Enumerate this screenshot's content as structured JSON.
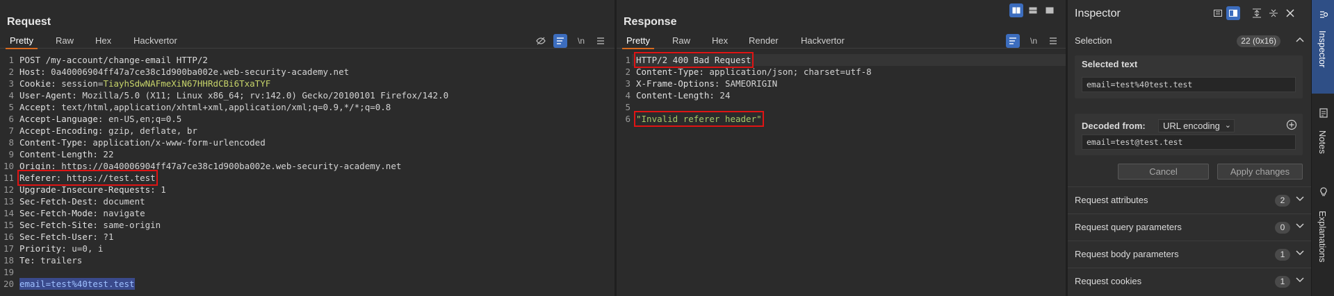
{
  "request": {
    "title": "Request",
    "tabs": [
      "Pretty",
      "Raw",
      "Hex",
      "Hackvertor"
    ],
    "lines": [
      {
        "n": "1",
        "text": "POST /my-account/change-email HTTP/2"
      },
      {
        "n": "2",
        "key": "Host",
        "value": "0a40006904ff47a7ce38c1d900ba002e.web-security-academy.net"
      },
      {
        "n": "3",
        "key": "Cookie",
        "value_prefix": "session=",
        "value": "TiayhSdwNAFmeXiN67HHRdCBi6TxaTYF"
      },
      {
        "n": "4",
        "key": "User-Agent",
        "value": "Mozilla/5.0 (X11; Linux x86_64; rv:142.0) Gecko/20100101 Firefox/142.0"
      },
      {
        "n": "5",
        "key": "Accept",
        "value": "text/html,application/xhtml+xml,application/xml;q=0.9,*/*;q=0.8"
      },
      {
        "n": "6",
        "key": "Accept-Language",
        "value": "en-US,en;q=0.5"
      },
      {
        "n": "7",
        "key": "Accept-Encoding",
        "value": "gzip, deflate, br"
      },
      {
        "n": "8",
        "key": "Content-Type",
        "value": "application/x-www-form-urlencoded"
      },
      {
        "n": "9",
        "key": "Content-Length",
        "value": "22"
      },
      {
        "n": "10",
        "key": "Origin",
        "value": "https://0a40006904ff47a7ce38c1d900ba002e.web-security-academy.net"
      },
      {
        "n": "11",
        "key": "Referer",
        "value": "https://test.test"
      },
      {
        "n": "12",
        "key": "Upgrade-Insecure-Requests",
        "value": "1"
      },
      {
        "n": "13",
        "key": "Sec-Fetch-Dest",
        "value": "document"
      },
      {
        "n": "14",
        "key": "Sec-Fetch-Mode",
        "value": "navigate"
      },
      {
        "n": "15",
        "key": "Sec-Fetch-Site",
        "value": "same-origin"
      },
      {
        "n": "16",
        "key": "Sec-Fetch-User",
        "value": "?1"
      },
      {
        "n": "17",
        "key": "Priority",
        "value": "u=0, i"
      },
      {
        "n": "18",
        "key": "Te",
        "value": "trailers"
      },
      {
        "n": "19",
        "text": ""
      },
      {
        "n": "20",
        "body_key": "email",
        "body_value": "test%40test.test"
      }
    ]
  },
  "response": {
    "title": "Response",
    "tabs": [
      "Pretty",
      "Raw",
      "Hex",
      "Render",
      "Hackvertor"
    ],
    "lines": [
      {
        "n": "1",
        "text": "HTTP/2 400 Bad Request"
      },
      {
        "n": "2",
        "key": "Content-Type",
        "value": "application/json; charset=utf-8"
      },
      {
        "n": "3",
        "key": "X-Frame-Options",
        "value": "SAMEORIGIN"
      },
      {
        "n": "4",
        "key": "Content-Length",
        "value": "24"
      },
      {
        "n": "5",
        "text": ""
      },
      {
        "n": "6",
        "text": "\"Invalid referer header\""
      }
    ]
  },
  "inspector": {
    "title": "Inspector",
    "selection": {
      "label": "Selection",
      "badge": "22 (0x16)"
    },
    "selected_text": {
      "label": "Selected text",
      "value": "email=test%40test.test"
    },
    "decoded": {
      "label": "Decoded from:",
      "encoding": "URL encoding",
      "value": "email=test@test.test"
    },
    "buttons": {
      "cancel": "Cancel",
      "apply": "Apply changes"
    },
    "sections": [
      {
        "label": "Request attributes",
        "count": "2"
      },
      {
        "label": "Request query parameters",
        "count": "0"
      },
      {
        "label": "Request body parameters",
        "count": "1"
      },
      {
        "label": "Request cookies",
        "count": "1"
      }
    ]
  },
  "rail": {
    "items": [
      "Inspector",
      "Notes",
      "Explanations"
    ]
  },
  "icons": {
    "toolbar_eye": "eye-off-icon",
    "toolbar_wrap": "format-icon",
    "toolbar_newline": "\\n",
    "toolbar_menu": "menu-icon"
  },
  "colors": {
    "accent": "#d86a1f",
    "highlight_box": "#e01414",
    "active_blue": "#3c6dbe"
  }
}
